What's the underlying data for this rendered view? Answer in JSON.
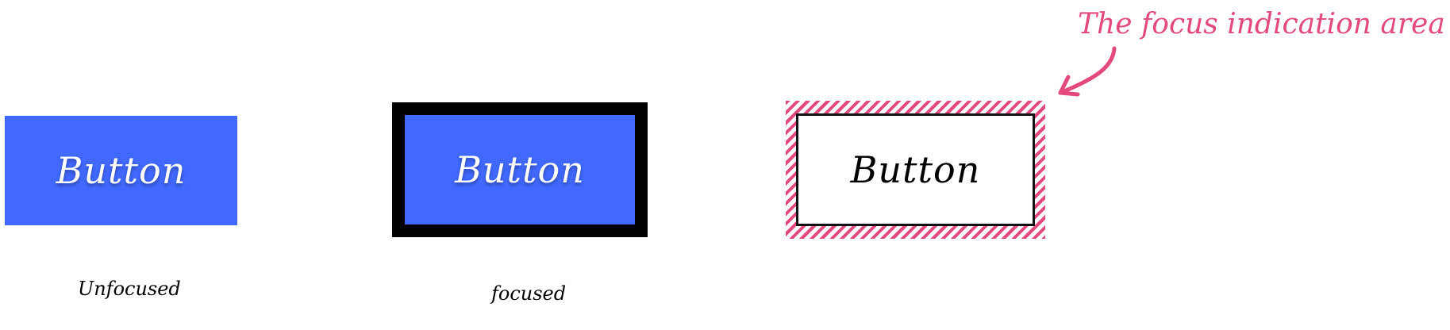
{
  "unfocused": {
    "button_label": "Button",
    "caption": "Unfocused"
  },
  "focused": {
    "button_label": "Button",
    "caption": "focused"
  },
  "focus_area": {
    "button_label": "Button",
    "annotation": "The focus indication area"
  },
  "colors": {
    "button_fill": "#4169ff",
    "focus_ring": "#000000",
    "annotation": "#e4497c"
  },
  "icons": {
    "pointer": "curved-arrow-icon"
  }
}
